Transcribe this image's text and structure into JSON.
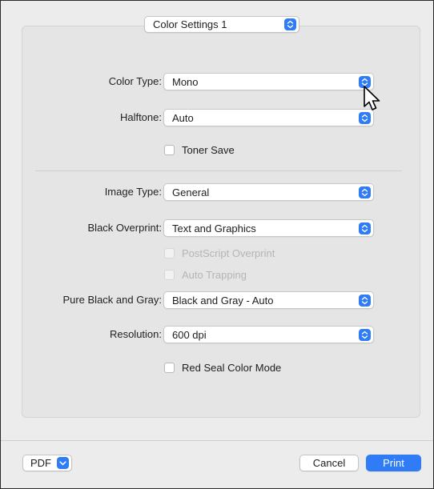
{
  "panel_menu": {
    "value": "Color Settings 1",
    "icon": "stepper-arrows-icon"
  },
  "color_type": {
    "label": "Color Type:",
    "value": "Mono"
  },
  "halftone": {
    "label": "Halftone:",
    "value": "Auto"
  },
  "toner_save": {
    "label": "Toner Save",
    "checked": false
  },
  "image_type": {
    "label": "Image Type:",
    "value": "General"
  },
  "black_overprint": {
    "label": "Black Overprint:",
    "value": "Text and Graphics"
  },
  "postscript_overprint": {
    "label": "PostScript Overprint",
    "checked": false,
    "enabled": false
  },
  "auto_trapping": {
    "label": "Auto Trapping",
    "checked": false,
    "enabled": false
  },
  "pure_black_gray": {
    "label": "Pure Black and Gray:",
    "value": "Black and Gray - Auto"
  },
  "resolution": {
    "label": "Resolution:",
    "value": "600 dpi"
  },
  "red_seal": {
    "label": "Red Seal Color Mode",
    "checked": false
  },
  "footer": {
    "pdf_label": "PDF",
    "cancel_label": "Cancel",
    "print_label": "Print"
  },
  "colors": {
    "accent": "#2f7cf6",
    "panel_bg": "#e5e5e5",
    "window_bg": "#ececec"
  }
}
